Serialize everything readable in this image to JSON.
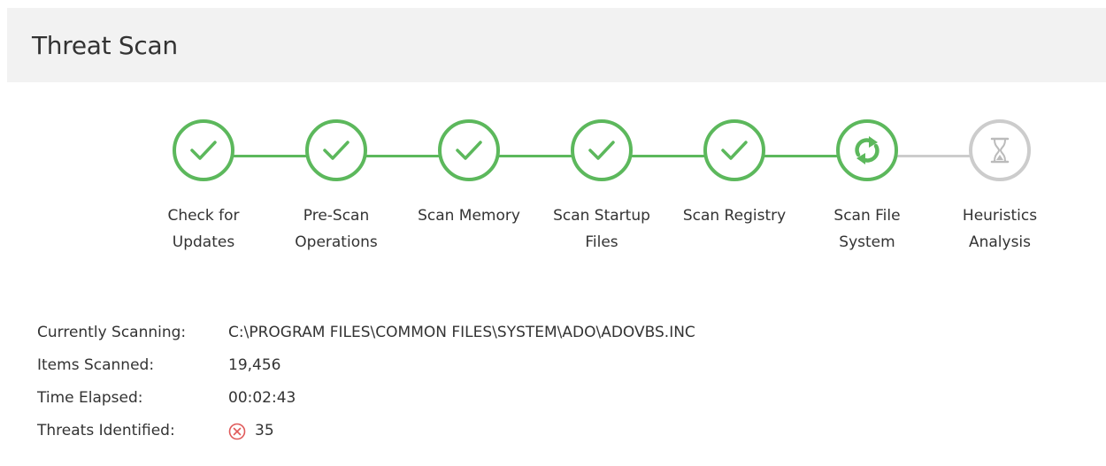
{
  "header": {
    "title": "Threat Scan"
  },
  "colors": {
    "complete": "#5cb85c",
    "pending": "#cccccc",
    "header_bg": "#f2f2f2",
    "threat": "#e05a5a"
  },
  "steps": [
    {
      "line1": "Check for",
      "line2": "Updates",
      "status": "complete",
      "icon": "checkmark-icon"
    },
    {
      "line1": "Pre-Scan",
      "line2": "Operations",
      "status": "complete",
      "icon": "checkmark-icon"
    },
    {
      "line1": "Scan Memory",
      "line2": "",
      "status": "complete",
      "icon": "checkmark-icon"
    },
    {
      "line1": "Scan Startup",
      "line2": "Files",
      "status": "complete",
      "icon": "checkmark-icon"
    },
    {
      "line1": "Scan Registry",
      "line2": "",
      "status": "complete",
      "icon": "checkmark-icon"
    },
    {
      "line1": "Scan File",
      "line2": "System",
      "status": "in-progress",
      "icon": "refresh-icon"
    },
    {
      "line1": "Heuristics",
      "line2": "Analysis",
      "status": "pending",
      "icon": "hourglass-icon"
    }
  ],
  "info": {
    "currently_scanning_label": "Currently Scanning:",
    "currently_scanning_value": "C:\\PROGRAM FILES\\COMMON FILES\\SYSTEM\\ADO\\ADOVBS.INC",
    "items_scanned_label": "Items Scanned:",
    "items_scanned_value": "19,456",
    "time_elapsed_label": "Time Elapsed:",
    "time_elapsed_value": "00:02:43",
    "threats_label": "Threats Identified:",
    "threats_value": "35",
    "threats_icon": "threat-x-icon"
  }
}
